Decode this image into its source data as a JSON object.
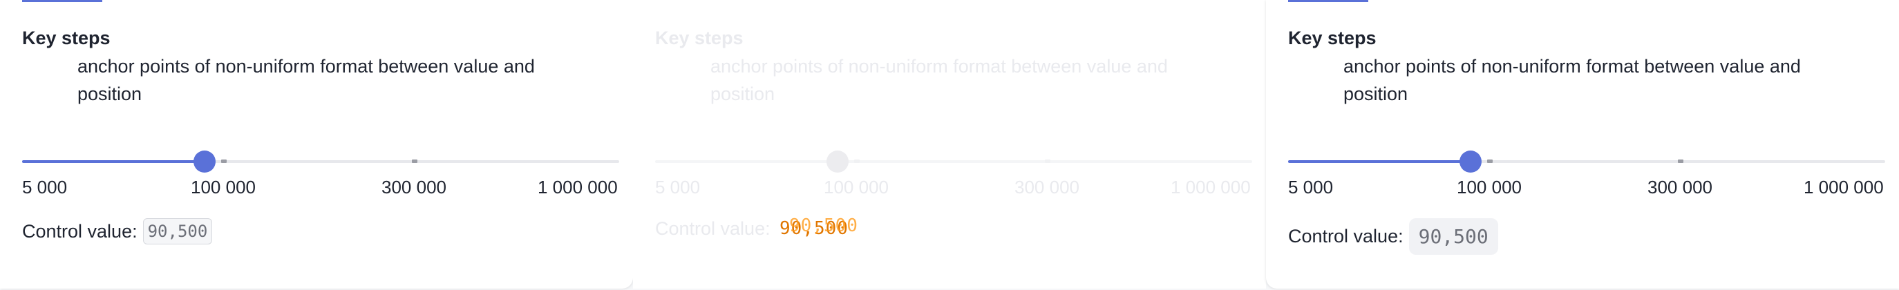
{
  "panels": [
    {
      "title": "Key steps",
      "description": "anchor points of non-uniform format between value and position",
      "slider": {
        "value": 90500,
        "fill_fraction": 0.305
      },
      "tick_labels": [
        "5 000",
        "100 000",
        "300 000",
        "1 000 000"
      ],
      "control_label": "Control value:",
      "control_value": "90,500"
    },
    {
      "title": "Key steps",
      "description": "anchor points of non-uniform format between value and position",
      "slider": {
        "value": 90500,
        "fill_fraction": 0.305
      },
      "tick_labels": [
        "5 000",
        "100 000",
        "300 000",
        "1 000 000"
      ],
      "control_label": "Control value:",
      "control_value": "90,500",
      "ghost_value": "90,500"
    },
    {
      "title": "Key steps",
      "description": "anchor points of non-uniform format between value and position",
      "slider": {
        "value": 90500,
        "fill_fraction": 0.305
      },
      "tick_labels": [
        "5 000",
        "100 000",
        "300 000",
        "1 000 000"
      ],
      "control_label": "Control value:",
      "control_value": "90,500"
    }
  ],
  "colors": {
    "accent": "#5a71d8",
    "overlay_text": "#e07600"
  }
}
